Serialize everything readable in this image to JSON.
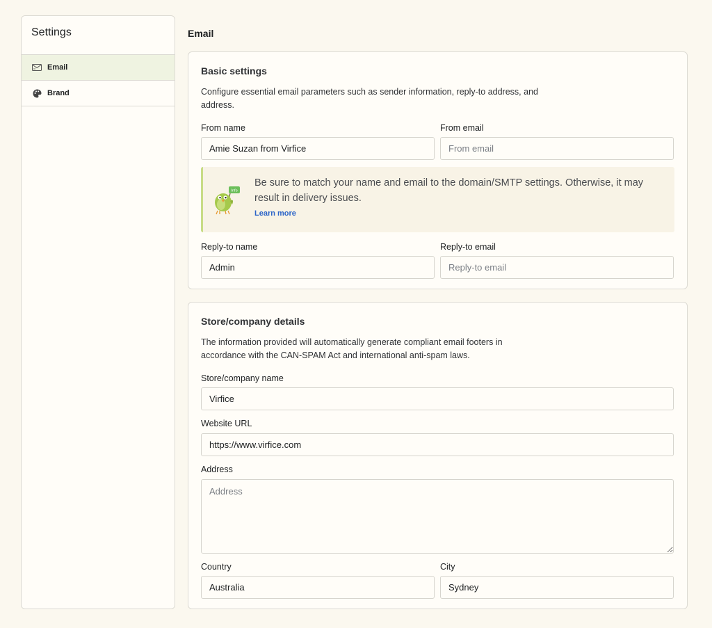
{
  "sidebar": {
    "title": "Settings",
    "items": [
      {
        "label": "Email",
        "icon": "envelope-icon",
        "active": true
      },
      {
        "label": "Brand",
        "icon": "palette-icon",
        "active": false
      }
    ]
  },
  "page": {
    "title": "Email"
  },
  "basic": {
    "title": "Basic settings",
    "description": "Configure essential email parameters such as sender information, reply-to address, and address.",
    "from_name": {
      "label": "From name",
      "value": "Amie Suzan from Virfice",
      "placeholder": "From name"
    },
    "from_email": {
      "label": "From email",
      "value": "",
      "placeholder": "From email"
    },
    "notice": {
      "text": "Be sure to match your name and email to the domain/SMTP settings. Otherwise, it may result in delivery issues.",
      "link": "Learn more",
      "icon": "parrot-mascot-icon"
    },
    "reply_name": {
      "label": "Reply-to name",
      "value": "Admin",
      "placeholder": "Reply-to name"
    },
    "reply_email": {
      "label": "Reply-to email",
      "value": "",
      "placeholder": "Reply-to email"
    }
  },
  "company": {
    "title": "Store/company details",
    "description": "The information provided will automatically generate compliant email footers in accordance with the CAN-SPAM Act and international anti-spam laws.",
    "store_name": {
      "label": "Store/company name",
      "value": "Virfice",
      "placeholder": "Store/company name"
    },
    "website": {
      "label": "Website URL",
      "value": "https://www.virfice.com",
      "placeholder": "Website URL"
    },
    "address": {
      "label": "Address",
      "value": "",
      "placeholder": "Address"
    },
    "country": {
      "label": "Country",
      "value": "Australia",
      "placeholder": "Country"
    },
    "city": {
      "label": "City",
      "value": "Sydney",
      "placeholder": "City"
    }
  },
  "colors": {
    "background": "#fbf8ef",
    "active_nav": "#eff3e1",
    "link": "#2a63c8",
    "notice_border": "#c8dc86"
  }
}
